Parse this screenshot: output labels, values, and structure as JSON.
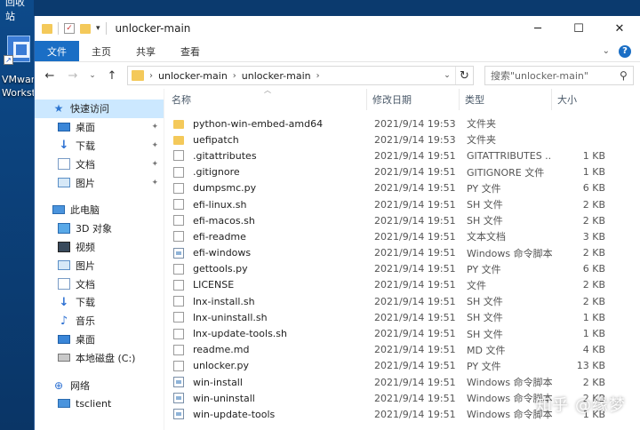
{
  "desktop": {
    "top_label": "回收站",
    "icon_label_line1": "VMwar",
    "icon_label_line2": "Worksta"
  },
  "window": {
    "title": "unlocker-main",
    "ribbon_tabs": [
      "文件",
      "主页",
      "共享",
      "查看"
    ],
    "address": [
      "unlocker-main",
      "unlocker-main"
    ],
    "search_placeholder": "搜索\"unlocker-main\""
  },
  "sidebar": {
    "quick_access": "快速访问",
    "quick_items": [
      "桌面",
      "下载",
      "文档",
      "图片"
    ],
    "this_pc": "此电脑",
    "pc_items": [
      "3D 对象",
      "视频",
      "图片",
      "文档",
      "下载",
      "音乐",
      "桌面",
      "本地磁盘 (C:)"
    ],
    "network": "网络",
    "tsclient": "tsclient"
  },
  "columns": {
    "name": "名称",
    "date": "修改日期",
    "type": "类型",
    "size": "大小"
  },
  "files": [
    {
      "name": "python-win-embed-amd64",
      "date": "2021/9/14 19:53",
      "type": "文件夹",
      "size": "",
      "icon": "folder"
    },
    {
      "name": "uefipatch",
      "date": "2021/9/14 19:53",
      "type": "文件夹",
      "size": "",
      "icon": "folder"
    },
    {
      "name": ".gitattributes",
      "date": "2021/9/14 19:51",
      "type": "GITATTRIBUTES ...",
      "size": "1 KB",
      "icon": "file"
    },
    {
      "name": ".gitignore",
      "date": "2021/9/14 19:51",
      "type": "GITIGNORE 文件",
      "size": "1 KB",
      "icon": "file"
    },
    {
      "name": "dumpsmc.py",
      "date": "2021/9/14 19:51",
      "type": "PY 文件",
      "size": "6 KB",
      "icon": "file"
    },
    {
      "name": "efi-linux.sh",
      "date": "2021/9/14 19:51",
      "type": "SH 文件",
      "size": "2 KB",
      "icon": "file"
    },
    {
      "name": "efi-macos.sh",
      "date": "2021/9/14 19:51",
      "type": "SH 文件",
      "size": "2 KB",
      "icon": "file"
    },
    {
      "name": "efi-readme",
      "date": "2021/9/14 19:51",
      "type": "文本文档",
      "size": "3 KB",
      "icon": "file"
    },
    {
      "name": "efi-windows",
      "date": "2021/9/14 19:51",
      "type": "Windows 命令脚本",
      "size": "2 KB",
      "icon": "bat"
    },
    {
      "name": "gettools.py",
      "date": "2021/9/14 19:51",
      "type": "PY 文件",
      "size": "6 KB",
      "icon": "file"
    },
    {
      "name": "LICENSE",
      "date": "2021/9/14 19:51",
      "type": "文件",
      "size": "2 KB",
      "icon": "file"
    },
    {
      "name": "lnx-install.sh",
      "date": "2021/9/14 19:51",
      "type": "SH 文件",
      "size": "2 KB",
      "icon": "file"
    },
    {
      "name": "lnx-uninstall.sh",
      "date": "2021/9/14 19:51",
      "type": "SH 文件",
      "size": "1 KB",
      "icon": "file"
    },
    {
      "name": "lnx-update-tools.sh",
      "date": "2021/9/14 19:51",
      "type": "SH 文件",
      "size": "1 KB",
      "icon": "file"
    },
    {
      "name": "readme.md",
      "date": "2021/9/14 19:51",
      "type": "MD 文件",
      "size": "4 KB",
      "icon": "file"
    },
    {
      "name": "unlocker.py",
      "date": "2021/9/14 19:51",
      "type": "PY 文件",
      "size": "13 KB",
      "icon": "file"
    },
    {
      "name": "win-install",
      "date": "2021/9/14 19:51",
      "type": "Windows 命令脚本",
      "size": "2 KB",
      "icon": "bat"
    },
    {
      "name": "win-uninstall",
      "date": "2021/9/14 19:51",
      "type": "Windows 命令脚本",
      "size": "2 KB",
      "icon": "bat"
    },
    {
      "name": "win-update-tools",
      "date": "2021/9/14 19:51",
      "type": "Windows 命令脚本",
      "size": "1 KB",
      "icon": "bat"
    }
  ],
  "watermark": "知乎 @缘梦"
}
